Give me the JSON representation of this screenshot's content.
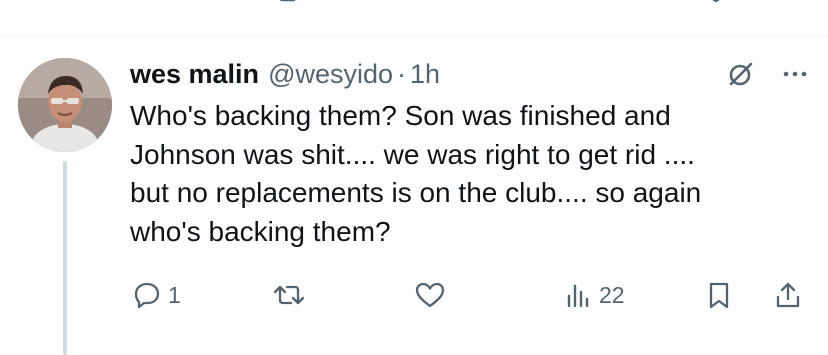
{
  "previous_tweet": {
    "actions": [
      "reply-icon",
      "retweet-icon",
      "like-icon",
      "views-icon",
      "bookmark-icon",
      "share-icon"
    ]
  },
  "reply": {
    "avatar_icon": "user-avatar",
    "author": {
      "name": "wes malin",
      "handle": "@wesyido",
      "separator": "·",
      "time": "1h"
    },
    "header_icons": [
      "grok-icon",
      "more-icon"
    ],
    "text_lines": [
      "Who's backing them? Son was finished and",
      "Johnson was shit.... we was right to get rid ....",
      "but no replacements is on the club.... so again",
      "who's backing them?"
    ],
    "actions": {
      "reply": {
        "icon": "reply-icon",
        "count": "1"
      },
      "retweet": {
        "icon": "retweet-icon",
        "count": ""
      },
      "like": {
        "icon": "like-icon",
        "count": ""
      },
      "views": {
        "icon": "views-icon",
        "count": "22"
      },
      "bookmark": {
        "icon": "bookmark-icon"
      },
      "share": {
        "icon": "share-icon"
      }
    }
  },
  "colors": {
    "text": "#0f1419",
    "secondary": "#536471",
    "divider": "#eff3f4",
    "thread_line": "#cfd9de",
    "like_accent": "#f91880"
  }
}
